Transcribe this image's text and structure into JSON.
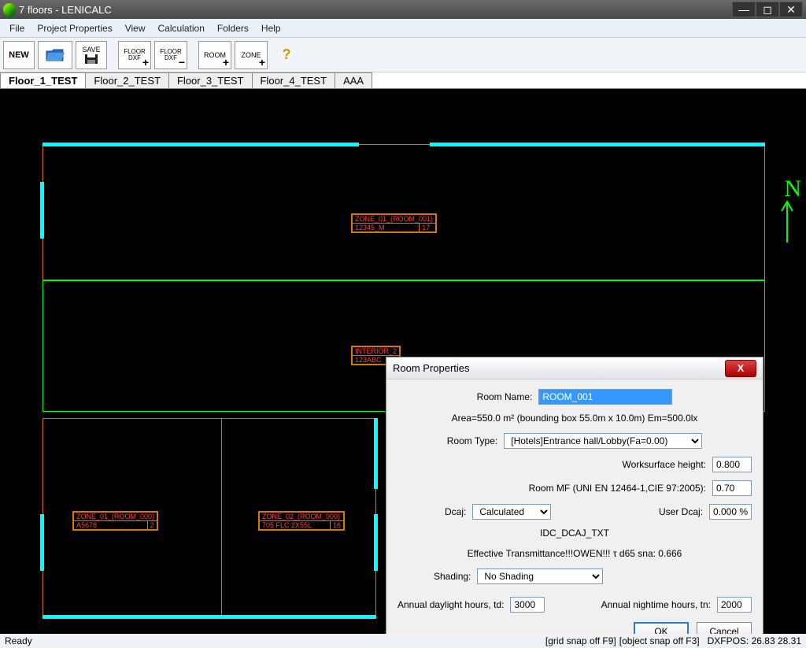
{
  "window": {
    "title": "7 floors - LENICALC"
  },
  "menu": [
    "File",
    "Project Properties",
    "View",
    "Calculation",
    "Folders",
    "Help"
  ],
  "toolbar": {
    "new": "NEW",
    "save": "SAVE",
    "floor_dxf_plus": "FLOOR\nDXF",
    "floor_dxf_minus": "FLOOR\nDXF",
    "room": "ROOM",
    "zone": "ZONE"
  },
  "tabs": [
    "Floor_1_TEST",
    "Floor_2_TEST",
    "Floor_3_TEST",
    "Floor_4_TEST",
    "AAA"
  ],
  "active_tab": 0,
  "compass": "N",
  "canvas_labels": {
    "zone01_top": {
      "name": "ZONE_01_(ROOM_001)",
      "code": "12345_M",
      "num": "17"
    },
    "interior": {
      "name": "INTERIOR_2",
      "code": "123ABC"
    },
    "zone01_bl": {
      "name": "ZONE_01_(ROOM_000)",
      "code": "A5678",
      "num": "2"
    },
    "zone02_bl": {
      "name": "ZONE_02_(ROOM_000)",
      "code": "705 FLC 2X55L",
      "num": "16"
    }
  },
  "dialog": {
    "title": "Room Properties",
    "room_name_label": "Room Name:",
    "room_name": "ROOM_001",
    "area_info": "Area=550.0 m²  (bounding box 55.0m x 10.0m) Em=500.0lx",
    "room_type_label": "Room Type:",
    "room_type": "[Hotels]Entrance hall/Lobby(Fa=0.00)",
    "worksurface_label": "Worksurface height:",
    "worksurface": "0.800",
    "room_mf_label": "Room MF (UNI EN 12464-1,CIE 97:2005):",
    "room_mf": "0.70",
    "dcaj_label": "Dcaj:",
    "dcaj": "Calculated",
    "user_dcaj_label": "User Dcaj:",
    "user_dcaj": "0.000 %",
    "idc_txt": "IDC_DCAJ_TXT",
    "transmittance": "Effective Transmittance!!!OWEN!!! τ d65 sna: 0.666",
    "shading_label": "Shading:",
    "shading": "No Shading",
    "td_label": "Annual daylight hours, td:",
    "td": "3000",
    "tn_label": "Annual nightime hours, tn:",
    "tn": "2000",
    "ok": "OK",
    "cancel": "Cancel"
  },
  "statusbar": {
    "ready": "Ready",
    "grid": "[grid snap off F9]",
    "object": "[object snap off F3]",
    "dxfpos": "DXFPOS: 26.83 28.31"
  }
}
